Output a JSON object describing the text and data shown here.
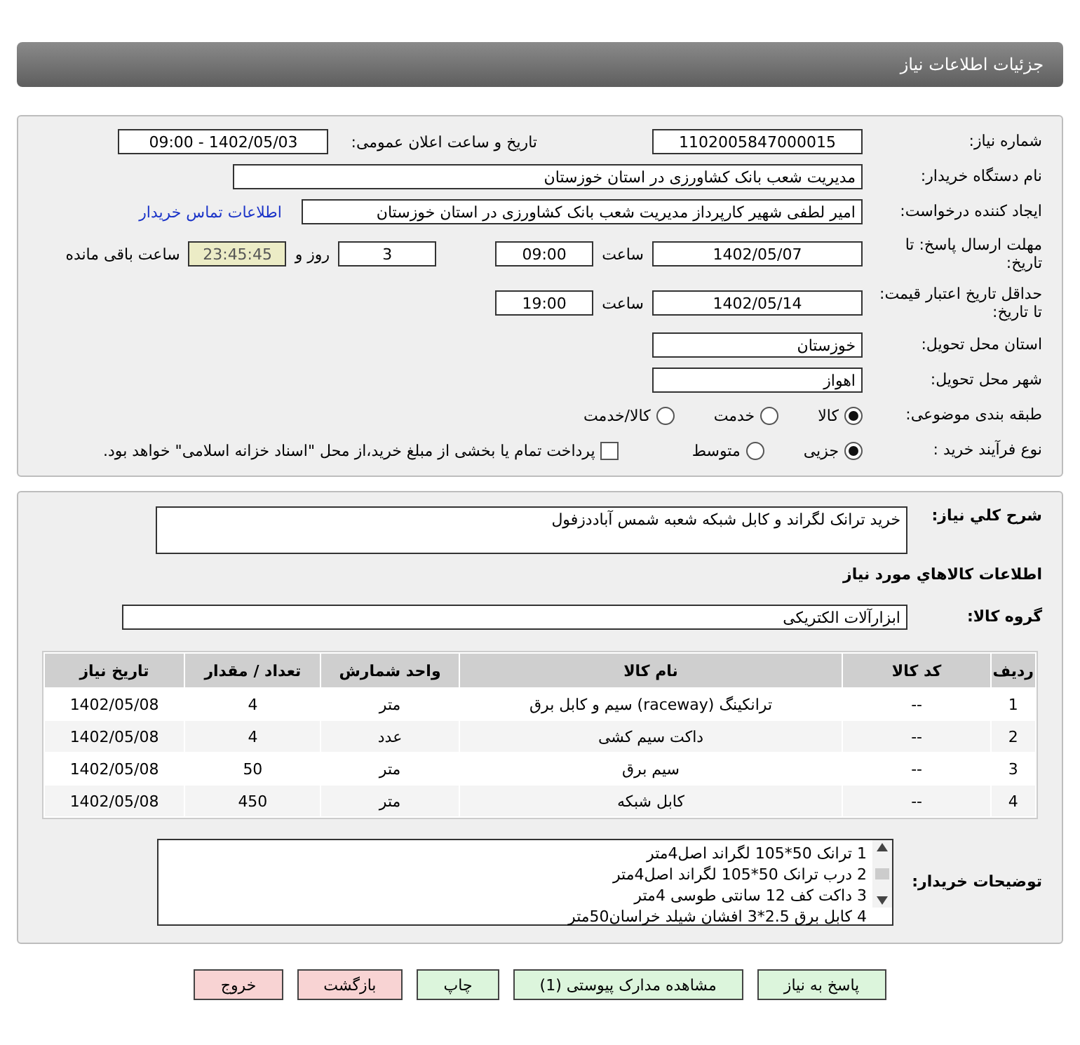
{
  "header": {
    "title": "جزئیات اطلاعات نیاز"
  },
  "need_number": {
    "label": "شماره نیاز:",
    "value": "1102005847000015"
  },
  "announce": {
    "label": "تاریخ و ساعت اعلان عمومی:",
    "value": "1402/05/03 - 09:00"
  },
  "buyer_org": {
    "label": "نام دستگاه خریدار:",
    "value": "مدیریت شعب بانک کشاورزی در استان خوزستان"
  },
  "requester": {
    "label": "ایجاد کننده درخواست:",
    "value": "امیر لطفی شهیر کارپرداز مدیریت شعب بانک کشاورزی در استان خوزستان",
    "link": "اطلاعات تماس خریدار"
  },
  "deadline": {
    "label": "مهلت ارسال پاسخ: تا تاریخ:",
    "date": "1402/05/07",
    "time_label": "ساعت",
    "time": "09:00",
    "days": "3",
    "days_label": "روز و",
    "remaining": "23:45:45",
    "remaining_label": "ساعت باقی مانده"
  },
  "validity": {
    "label": "حداقل تاریخ اعتبار قیمت: تا تاریخ:",
    "date": "1402/05/14",
    "time_label": "ساعت",
    "time": "19:00"
  },
  "province": {
    "label": "استان محل تحویل:",
    "value": "خوزستان"
  },
  "city": {
    "label": "شهر محل تحویل:",
    "value": "اهواز"
  },
  "category": {
    "label": "طبقه بندی موضوعی:",
    "options": [
      {
        "label": "کالا",
        "selected": true
      },
      {
        "label": "خدمت",
        "selected": false
      },
      {
        "label": "کالا/خدمت",
        "selected": false
      }
    ]
  },
  "process": {
    "label": "نوع فرآیند خرید :",
    "options": [
      {
        "label": "جزیی",
        "selected": true
      },
      {
        "label": "متوسط",
        "selected": false
      }
    ],
    "treasury": {
      "checked": false,
      "text": "پرداخت تمام یا بخشی از مبلغ خرید،از محل \"اسناد خزانه اسلامی\" خواهد بود."
    }
  },
  "description": {
    "label": "شرح کلي نياز:",
    "value": "خرید ترانک لگراند و کابل شبکه شعبه شمس آباددزفول"
  },
  "goods_title": "اطلاعات کالاهاي مورد نياز",
  "goods_group": {
    "label": "گروه کالا:",
    "value": "ابزارآلات الکتریکی"
  },
  "table": {
    "columns": [
      "ردیف",
      "کد کالا",
      "نام کالا",
      "واحد شمارش",
      "تعداد / مقدار",
      "تاریخ نیاز"
    ],
    "rows": [
      [
        "1",
        "--",
        "ترانکینگ (raceway) سیم و کابل برق",
        "متر",
        "4",
        "1402/05/08"
      ],
      [
        "2",
        "--",
        "داکت سیم کشی",
        "عدد",
        "4",
        "1402/05/08"
      ],
      [
        "3",
        "--",
        "سیم برق",
        "متر",
        "50",
        "1402/05/08"
      ],
      [
        "4",
        "--",
        "کابل شبکه",
        "متر",
        "450",
        "1402/05/08"
      ]
    ]
  },
  "buyer_notes": {
    "label": "توضیحات خریدار:",
    "lines": [
      "1 ترانک 50*105 لگراند اصل4متر",
      "2 درب ترانک 50*105 لگراند اصل4متر",
      "3 داکت کف 12 سانتی طوسی 4متر",
      "4 کابل برق 2.5*3 افشان شیلد خراسان50متر"
    ]
  },
  "buttons": [
    {
      "label": "پاسخ به نیاز",
      "kind": "normal"
    },
    {
      "label": "مشاهده مدارک پیوستی (1)",
      "kind": "normal"
    },
    {
      "label": "چاپ",
      "kind": "normal"
    },
    {
      "label": "بازگشت",
      "kind": "exit"
    },
    {
      "label": "خروج",
      "kind": "exit"
    }
  ]
}
